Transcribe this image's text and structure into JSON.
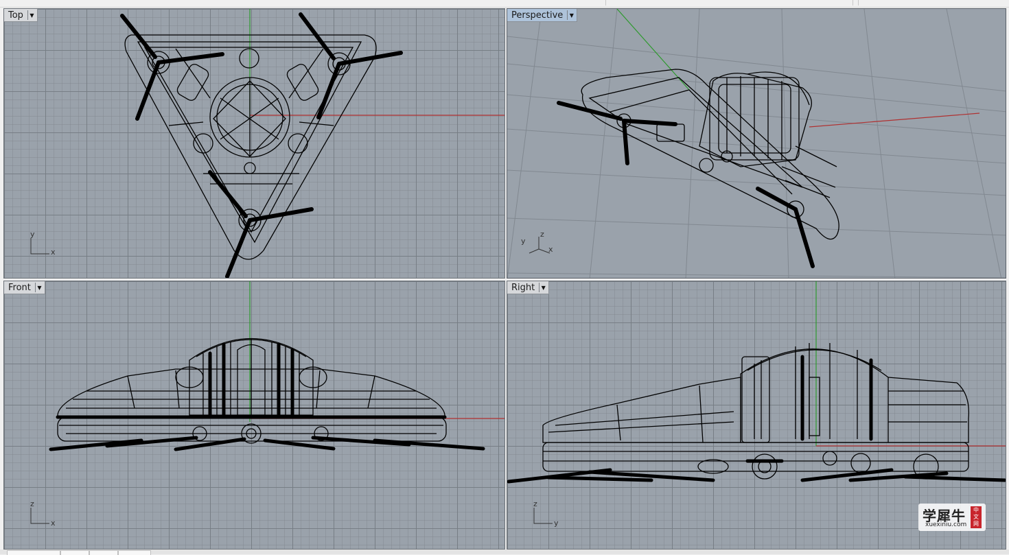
{
  "viewports": {
    "top": {
      "label": "Top",
      "axes": [
        "y",
        "x"
      ]
    },
    "perspective": {
      "label": "Perspective",
      "axes": [
        "z",
        "y",
        "x"
      ]
    },
    "front": {
      "label": "Front",
      "axes": [
        "z",
        "x"
      ]
    },
    "right": {
      "label": "Right",
      "axes": [
        "z",
        "y"
      ]
    }
  },
  "watermark": {
    "chinese": "学犀牛",
    "url": "xuexiniu.com",
    "badge": [
      "中",
      "文",
      "网"
    ]
  },
  "colors": {
    "viewport_bg": "#9aa2ab",
    "x_axis": "#b03030",
    "y_axis": "#2e9a2e",
    "wire": "#000000"
  },
  "icons": {
    "viewport_menu": "chevron-down-icon"
  }
}
